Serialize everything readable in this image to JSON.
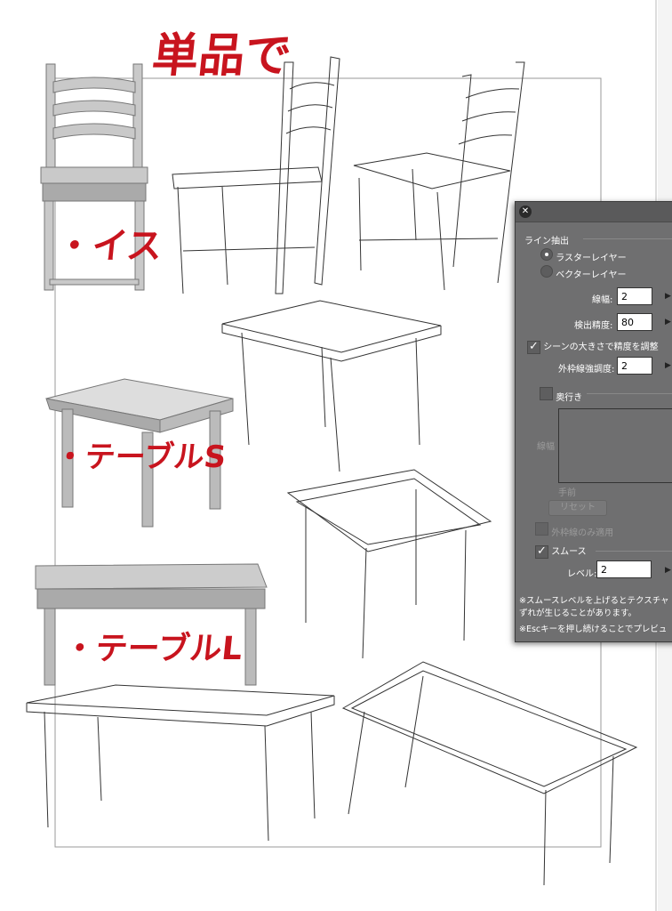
{
  "notes": {
    "title": "単品で",
    "chair": "・イス",
    "table_s": "・テーブルS",
    "table_l": "・テーブルL"
  },
  "panel": {
    "section_title": "ライン抽出",
    "radio_raster": "ラスターレイヤー",
    "radio_vector": "ベクターレイヤー",
    "line_width_label": "線幅:",
    "line_width_value": "2",
    "precision_label": "検出精度:",
    "precision_value": "80",
    "scene_adjust_label": "シーンの大きさで精度を調整",
    "outline_label": "外枠線強調度:",
    "outline_value": "2",
    "depth_label": "奥行き",
    "depth_width_label": "線幅",
    "front_label": "手前",
    "reset_label": "リセット",
    "outline_only_label": "外枠線のみ適用",
    "smooth_label": "スムース",
    "level_label": "レベル:",
    "level_value": "2",
    "note1_line1": "※スムースレベルを上げるとテクスチャ",
    "note1_line2": "ずれが生じることがあります。",
    "note2": "※Escキーを押し続けることでプレビュ"
  }
}
